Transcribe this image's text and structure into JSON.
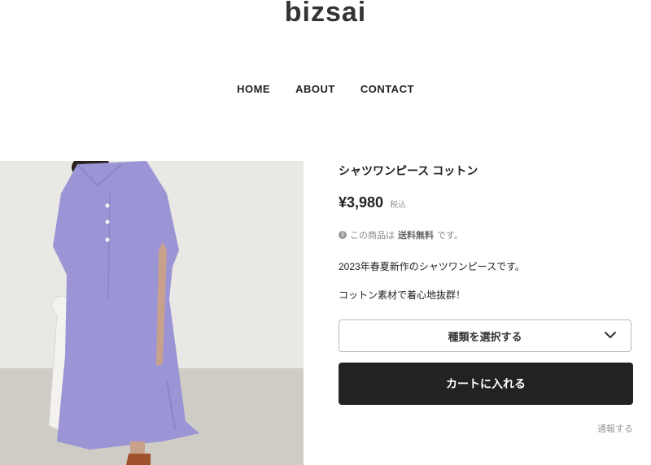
{
  "shop": {
    "name": "bizsai"
  },
  "nav": {
    "items": [
      "HOME",
      "ABOUT",
      "CONTACT"
    ]
  },
  "product": {
    "title": "シャツワンピース コットン",
    "price": "¥3,980",
    "tax_label": "税込",
    "shipping_prefix": "この商品は",
    "shipping_emph": "送料無料",
    "shipping_suffix": "です。",
    "description_1": "2023年春夏新作のシャツワンピースです。",
    "description_2": "コットン素材で着心地抜群！",
    "variant_select": "種類を選択する",
    "add_to_cart": "カートに入れる",
    "report": "通報する"
  },
  "colors": {
    "accent": "#222222",
    "dress": "#9b95d6"
  },
  "icons": {
    "info": "info-icon",
    "chevron": "chevron-down-icon"
  }
}
